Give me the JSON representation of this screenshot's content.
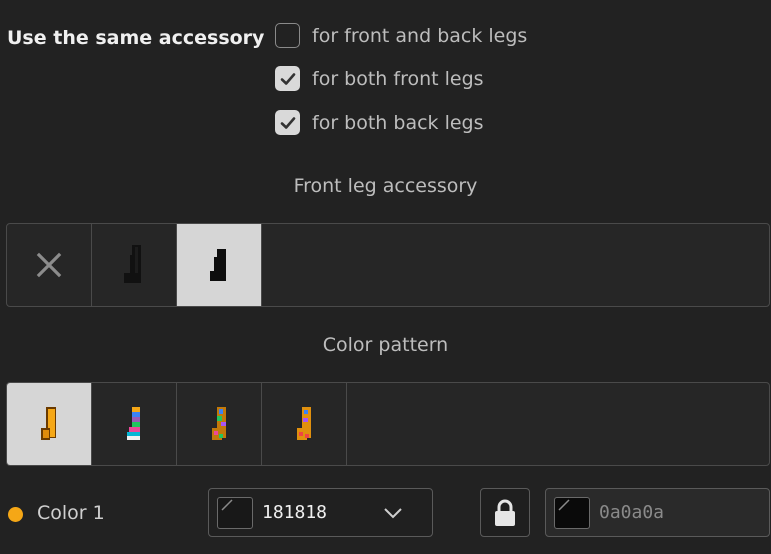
{
  "accessory": {
    "same_label": "Use the same accessory",
    "options": [
      {
        "label": "for front and back legs",
        "checked": false
      },
      {
        "label": "for both front legs",
        "checked": true
      },
      {
        "label": "for both back legs",
        "checked": true
      }
    ]
  },
  "front_leg": {
    "title": "Front leg accessory",
    "items": [
      "none-icon",
      "leg-sock-icon",
      "leg-sock-icon"
    ],
    "selected_index": 2
  },
  "pattern": {
    "title": "Color pattern",
    "items": [
      "orange-sock-icon",
      "rainbow-sock-icon",
      "multicolor-sock-icon",
      "multicolor-sock-icon"
    ],
    "selected_index": 0
  },
  "color1": {
    "label": "Color 1",
    "dot_color": "#f5a716",
    "hex": "181818",
    "locked_hex": "0a0a0a"
  }
}
